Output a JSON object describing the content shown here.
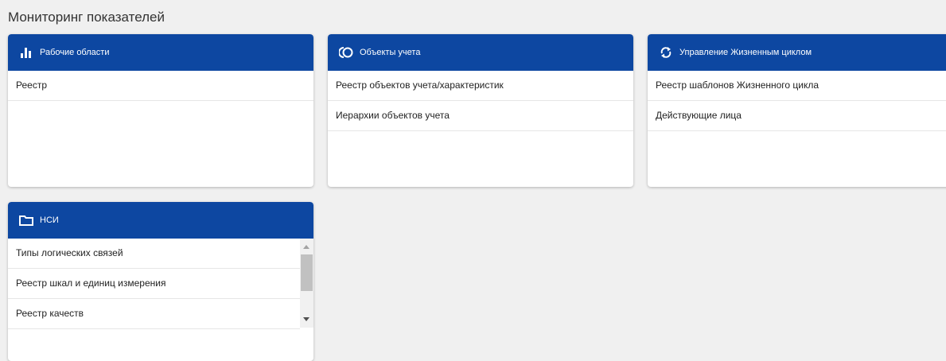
{
  "page": {
    "title": "Мониторинг показателей"
  },
  "cards": {
    "workspaces": {
      "title": "Рабочие области",
      "icon": "bar-chart-icon",
      "items": [
        "Реестр"
      ]
    },
    "accounting_objects": {
      "title": "Объекты учета",
      "icon": "circle-objects-icon",
      "items": [
        "Реестр объектов учета/характеристик",
        "Иерархии объектов учета"
      ]
    },
    "lifecycle": {
      "title": "Управление Жизненным циклом",
      "icon": "refresh-icon",
      "items": [
        "Реестр шаблонов Жизненного цикла",
        "Действующие лица"
      ]
    },
    "nsi": {
      "title": "НСИ",
      "icon": "folder-icon",
      "items": [
        "Типы логических связей",
        "Реестр шкал и единиц измерения",
        "Реестр качеств"
      ]
    }
  },
  "colors": {
    "header": "#0d47a1",
    "background": "#f0f0f0"
  }
}
